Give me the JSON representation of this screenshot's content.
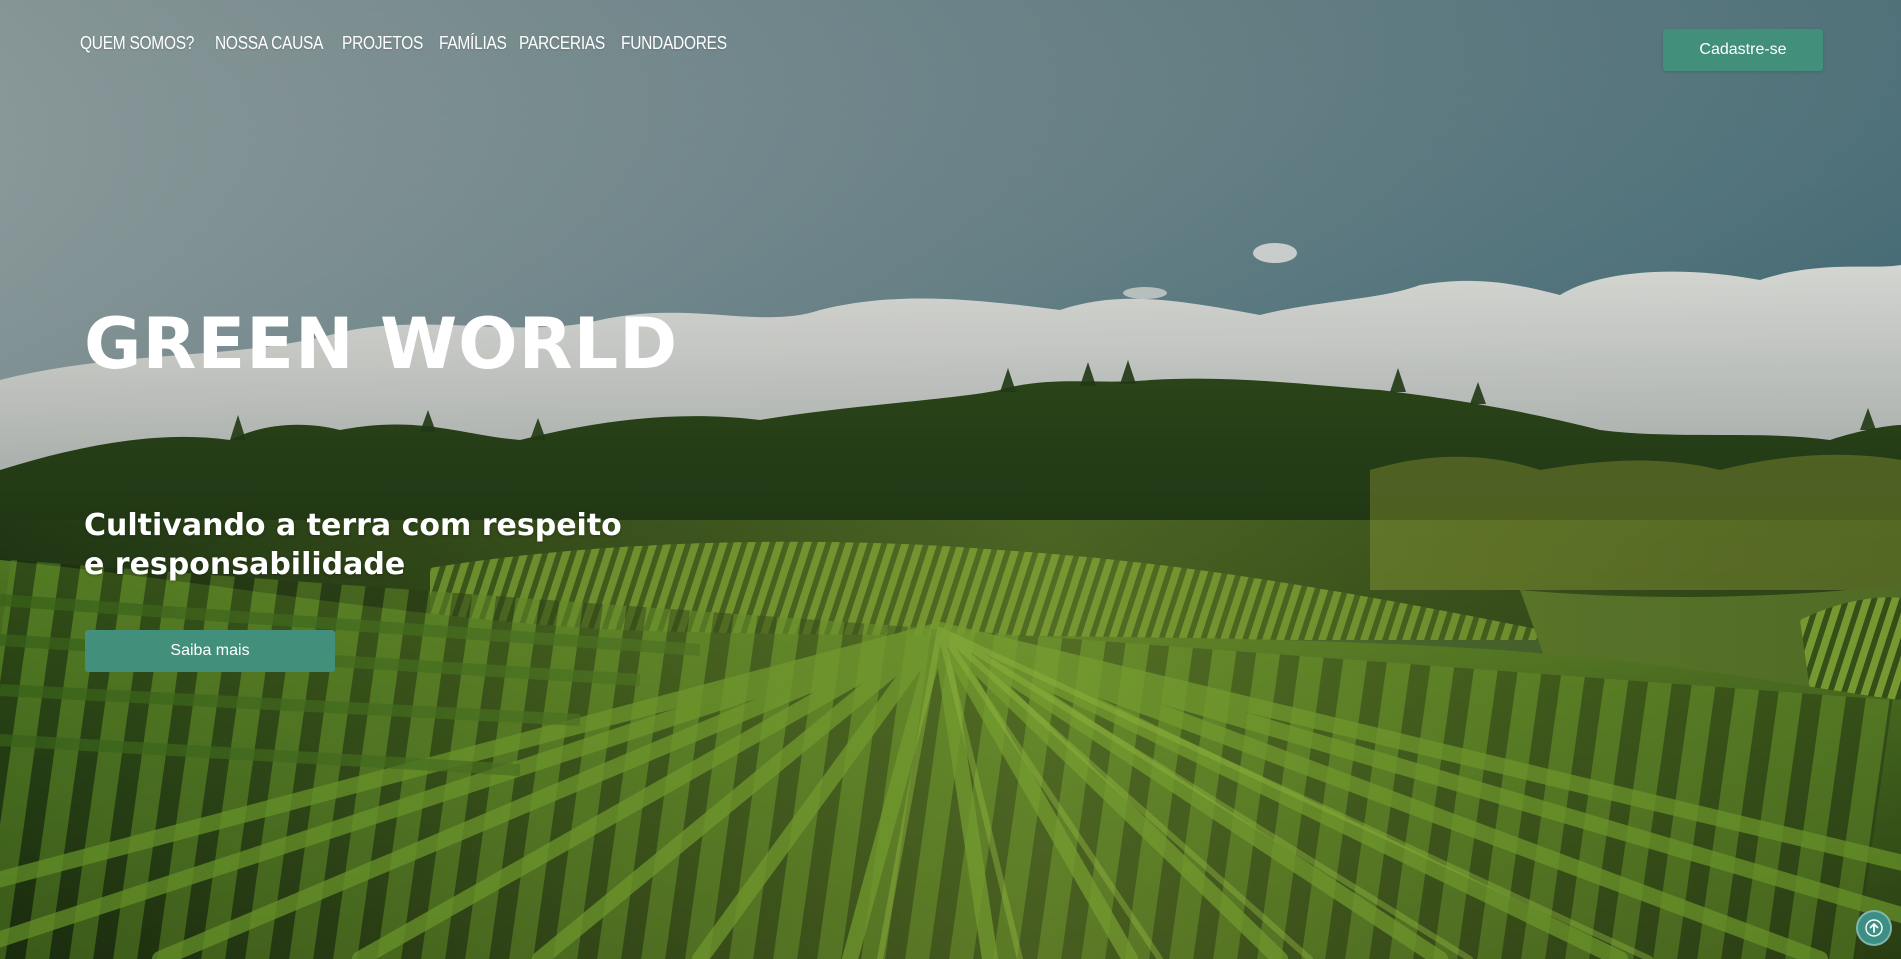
{
  "nav": {
    "items": [
      {
        "label": "QUEM SOMOS?"
      },
      {
        "label": "NOSSA CAUSA"
      },
      {
        "label": "PROJETOS"
      },
      {
        "label": "FAMÍLIAS"
      },
      {
        "label": "PARCERIAS"
      },
      {
        "label": "FUNDADORES"
      }
    ],
    "signup_label": "Cadastre-se"
  },
  "hero": {
    "title": "GREEN WORLD",
    "subtitle_line1": "Cultivando a terra com respeito",
    "subtitle_line2": "e responsabilidade",
    "cta_label": "Saiba mais",
    "background_icon": "vineyard-landscape-image"
  },
  "back_to_top": {
    "icon": "arrow-up-icon"
  },
  "colors": {
    "accent": "#42907b",
    "text": "#ffffff",
    "sky_top": "#4e7884",
    "sky_left": "#9aa6a6",
    "vineyard": "#3f6a22"
  }
}
